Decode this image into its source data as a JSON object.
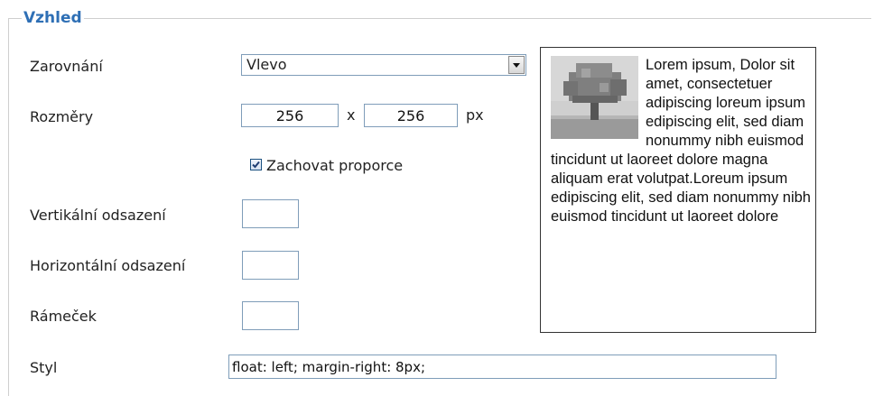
{
  "legend": "Vzhled",
  "fields": {
    "alignment": {
      "label": "Zarovnání",
      "value": "Vlevo"
    },
    "dimensions": {
      "label": "Rozměry",
      "width": "256",
      "separator": "x",
      "height": "256",
      "unit": "px"
    },
    "keep_ratio": {
      "label": "Zachovat proporce",
      "checked": true
    },
    "vspace": {
      "label": "Vertikální odsazení",
      "value": ""
    },
    "hspace": {
      "label": "Horizontální odsazení",
      "value": ""
    },
    "border": {
      "label": "Rámeček",
      "value": ""
    },
    "style": {
      "label": "Styl",
      "value": "float: left; margin-right: 8px;"
    }
  },
  "preview": {
    "text": "Lorem ipsum, Dolor sit amet, consectetuer adipiscing loreum ipsum edipiscing elit, sed diam nonummy nibh euismod tincidunt ut laoreet dolore magna aliquam erat volutpat.Loreum ipsum edipiscing elit, sed diam nonummy nibh euismod tincidunt ut laoreet dolore"
  }
}
